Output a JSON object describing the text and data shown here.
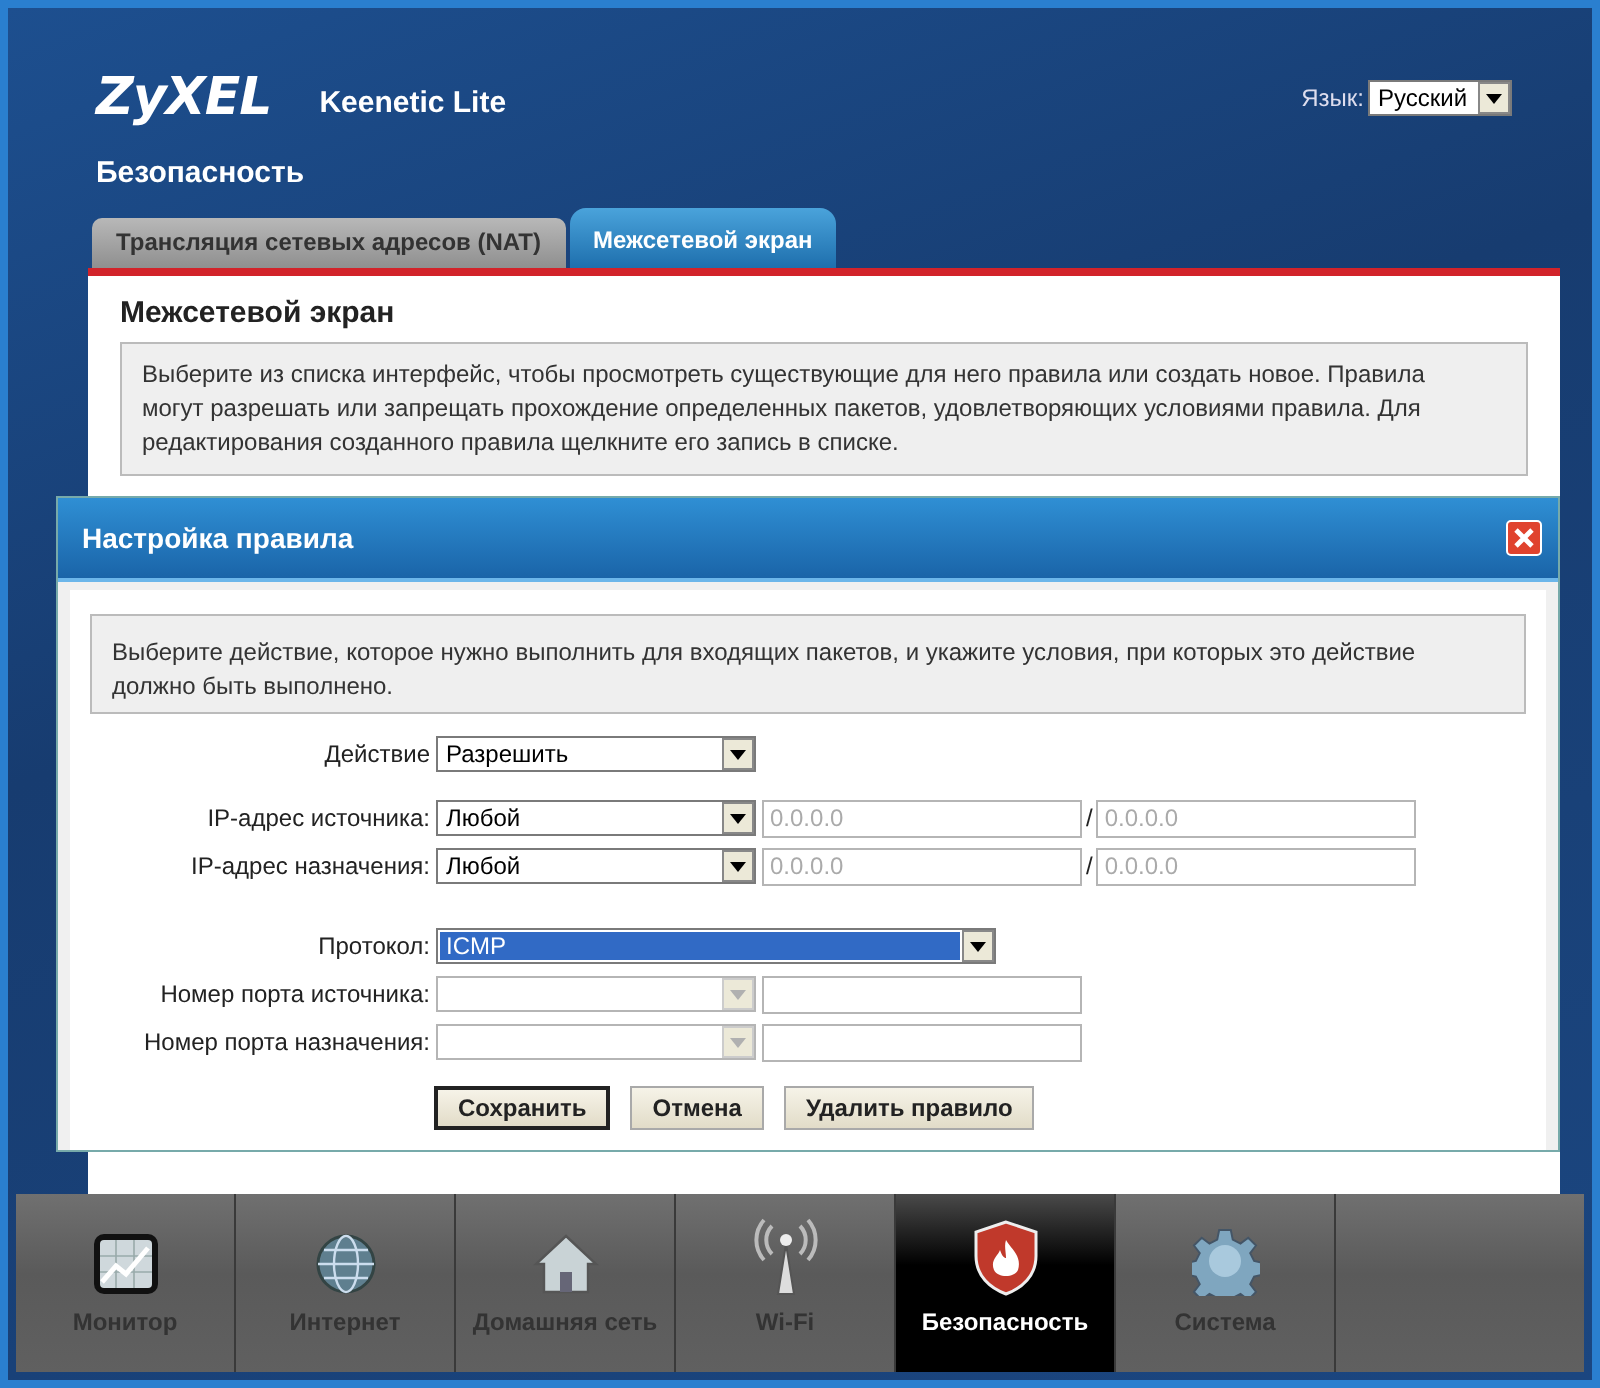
{
  "header": {
    "logo": "ZyXEL",
    "model": "Keenetic Lite",
    "language_label": "Язык:",
    "language": "Русский"
  },
  "page_title": "Безопасность",
  "tabs": [
    {
      "label": "Трансляция сетевых адресов (NAT)",
      "selected": false
    },
    {
      "label": "Межсетевой экран",
      "selected": true
    }
  ],
  "panel": {
    "heading": "Межсетевой экран",
    "description": "Выберите из списка интерфейс, чтобы просмотреть существующие для него правила или создать новое. Правила могут разрешать или запрещать прохождение определенных пакетов, удовлетворяющих условиями правила. Для редактирования созданного правила щелкните его запись в списке."
  },
  "dialog": {
    "title": "Настройка правила",
    "description": "Выберите действие, которое нужно выполнить для входящих пакетов, и укажите условия, при которых это действие должно быть выполнено.",
    "rows": [
      {
        "kind": "select",
        "label": "Действие",
        "value": "Разрешить",
        "focused": false,
        "disabled": false
      },
      {
        "kind": "address",
        "label": "IP-адрес источника:",
        "value": "Любой",
        "disabled": false,
        "address": "0.0.0.0",
        "separator": "/",
        "mask": "0.0.0.0",
        "inputs_disabled": true
      },
      {
        "kind": "address",
        "label": "IP-адрес назначения:",
        "value": "Любой",
        "disabled": false,
        "address": "0.0.0.0",
        "separator": "/",
        "mask": "0.0.0.0",
        "inputs_disabled": true
      },
      {
        "kind": "wide",
        "label": "Протокол:",
        "value": "ICMP",
        "focused": true,
        "disabled": false
      },
      {
        "kind": "port",
        "label": "Номер порта источника:",
        "disabled": true
      },
      {
        "kind": "port",
        "label": "Номер порта назначения:",
        "disabled": true
      }
    ],
    "buttons": [
      {
        "label": "Сохранить",
        "default": true
      },
      {
        "label": "Отмена",
        "default": false
      },
      {
        "label": "Удалить правило",
        "default": false
      }
    ]
  },
  "nav": [
    {
      "label": "Монитор",
      "selected": false
    },
    {
      "label": "Интернет",
      "selected": false
    },
    {
      "label": "Домашняя сеть",
      "selected": false
    },
    {
      "label": "Wi-Fi",
      "selected": false
    },
    {
      "label": "Безопасность",
      "selected": true
    },
    {
      "label": "Система",
      "selected": false
    }
  ]
}
